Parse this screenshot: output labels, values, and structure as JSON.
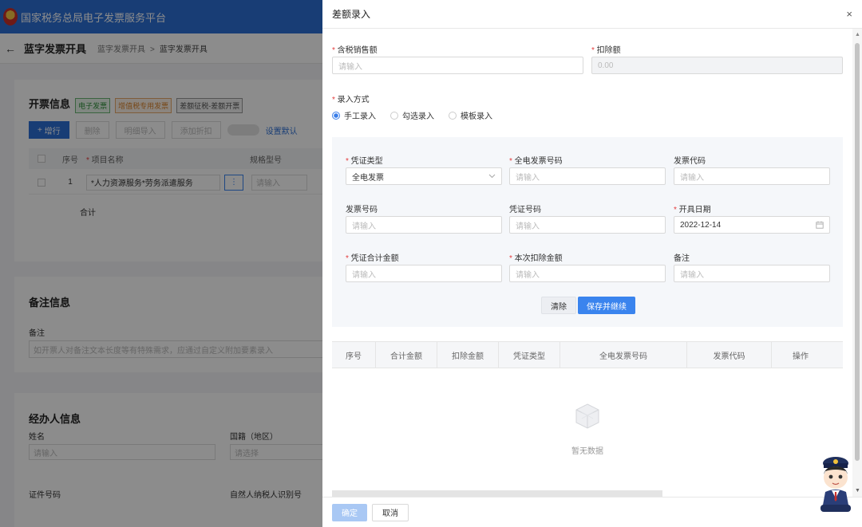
{
  "bg": {
    "platform_title": "国家税务总局电子发票服务平台",
    "page_title": "蓝字发票开具",
    "breadcrumb": [
      "蓝字发票开具",
      "蓝字发票开具"
    ],
    "invoice_section": {
      "title": "开票信息",
      "tags": [
        "电子发票",
        "增值税专用发票",
        "差额征税-差额开票"
      ],
      "buttons": [
        "增行",
        "删除",
        "明细导入",
        "添加折扣"
      ],
      "set_default": "设置默认",
      "columns": [
        "序号",
        "项目名称",
        "规格型号"
      ],
      "row": {
        "index": "1",
        "item_name": "*人力资源服务*劳务派遣服务",
        "spec_placeholder": "请输入"
      },
      "total_label": "合计"
    },
    "remark_section": {
      "title": "备注信息",
      "label": "备注",
      "placeholder": "如开票人对备注文本长度等有特殊需求，应通过自定义附加要素录入"
    },
    "agent_section": {
      "title": "经办人信息",
      "name_label": "姓名",
      "name_placeholder": "请输入",
      "nationality_label": "国籍（地区）",
      "nationality_placeholder": "请选择",
      "id_label": "证件号码",
      "taxpayer_label": "自然人纳税人识别号"
    }
  },
  "dialog": {
    "title": "差额录入",
    "close_label": "×",
    "total_sales_label": "含税销售额",
    "total_sales_placeholder": "请输入",
    "deduction_label": "扣除额",
    "deduction_value": "0.00",
    "entry_mode_label": "录入方式",
    "entry_modes": [
      "手工录入",
      "勾选录入",
      "模板录入"
    ],
    "selected_mode": "手工录入",
    "form": {
      "voucher_type_label": "凭证类型",
      "voucher_type_value": "全电发票",
      "full_invoice_no_label": "全电发票号码",
      "full_invoice_no_placeholder": "请输入",
      "invoice_code_label": "发票代码",
      "invoice_code_placeholder": "请输入",
      "invoice_no_label": "发票号码",
      "invoice_no_placeholder": "请输入",
      "voucher_no_label": "凭证号码",
      "voucher_no_placeholder": "请输入",
      "issue_date_label": "开具日期",
      "issue_date_value": "2022-12-14",
      "voucher_total_label": "凭证合计金额",
      "voucher_total_placeholder": "请输入",
      "current_deduction_label": "本次扣除金额",
      "current_deduction_placeholder": "请输入",
      "remark_label": "备注",
      "remark_placeholder": "请输入",
      "clear_button": "清除",
      "save_continue_button": "保存并继续"
    },
    "table_columns": [
      "序号",
      "合计金额",
      "扣除金额",
      "凭证类型",
      "全电发票号码",
      "发票代码",
      "操作"
    ],
    "empty_text": "暂无数据",
    "confirm_button": "确定",
    "cancel_button": "取消"
  },
  "colors": {
    "primary": "#3a84ee",
    "header_blue": "#2c6fd6",
    "required": "#e43c3c"
  },
  "icons": [
    "back-arrow-icon",
    "close-icon",
    "chevron-down-icon",
    "calendar-icon",
    "empty-box-icon",
    "more-icon"
  ]
}
